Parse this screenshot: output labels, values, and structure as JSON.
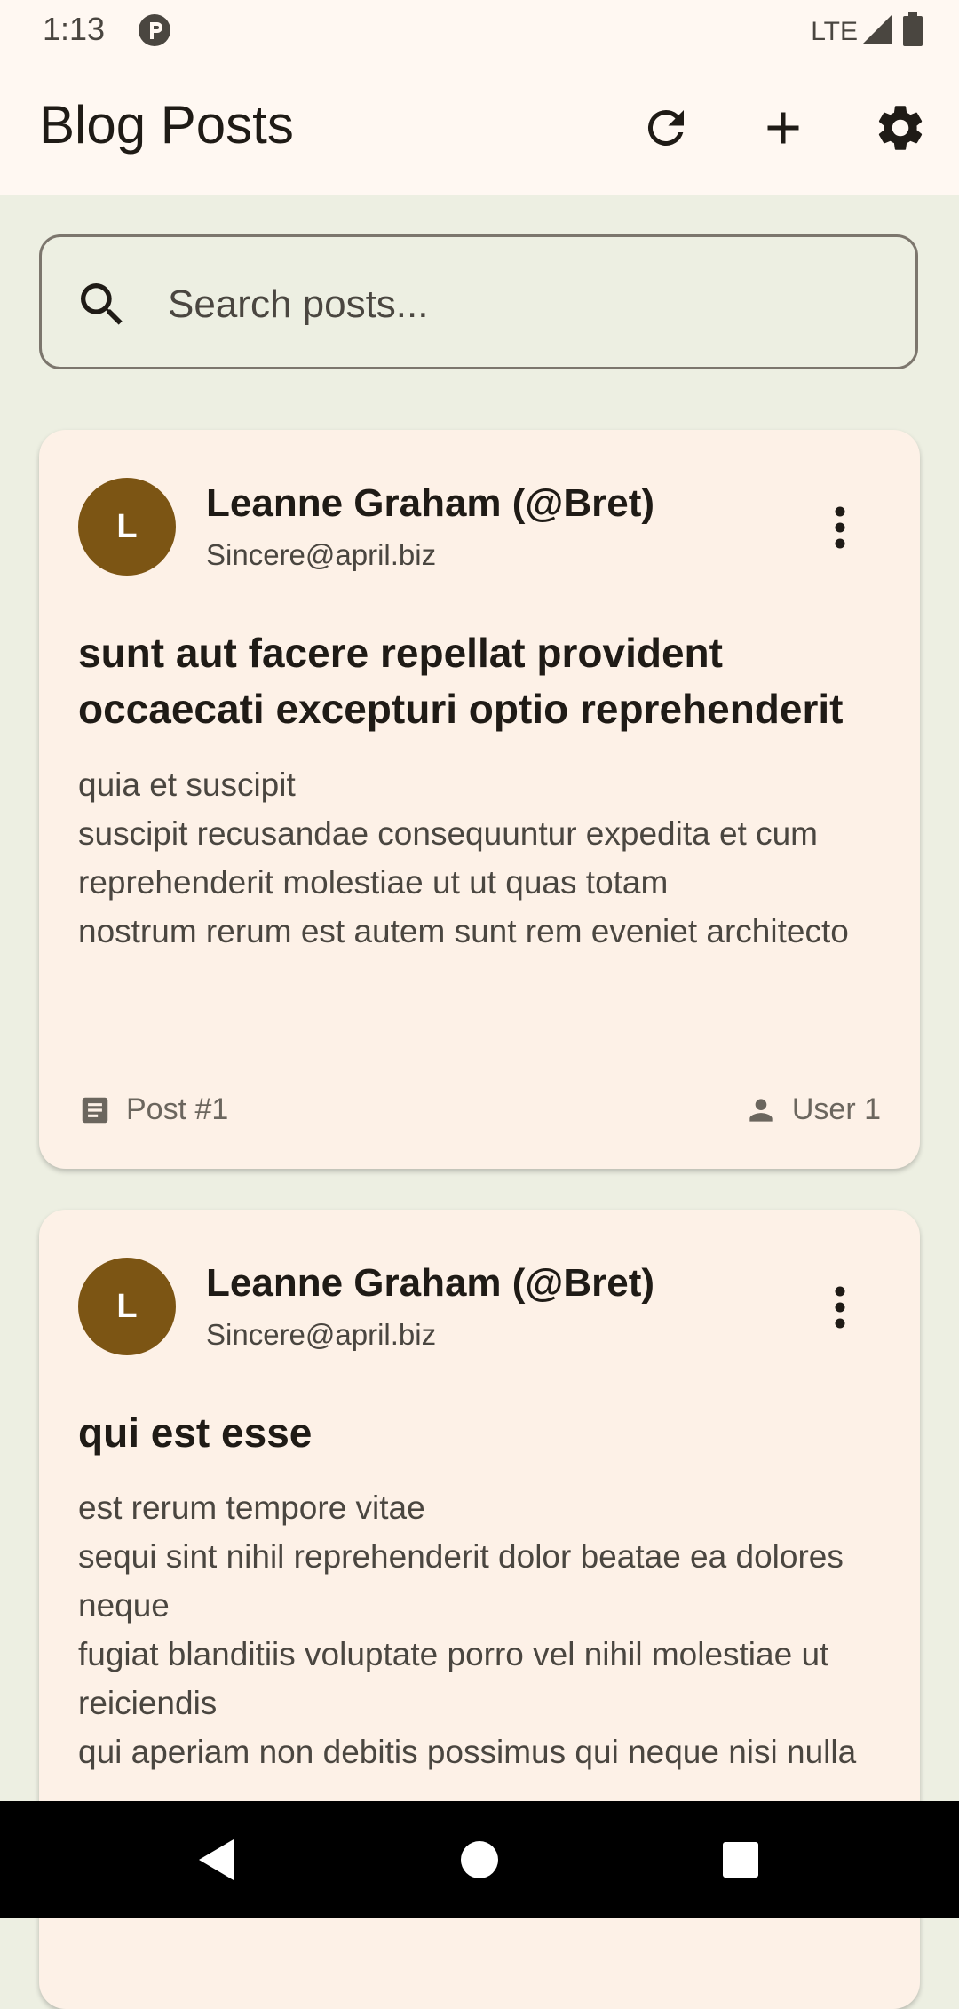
{
  "status_bar": {
    "time": "1:13",
    "network": "LTE"
  },
  "app_bar": {
    "title": "Blog Posts",
    "actions": [
      "refresh-icon",
      "add-icon",
      "settings-icon"
    ]
  },
  "search": {
    "placeholder": "Search posts..."
  },
  "posts": [
    {
      "author_initial": "L",
      "author_name": "Leanne Graham (@Bret)",
      "author_email": "Sincere@april.biz",
      "title": "sunt aut facere repellat provident occaecati excepturi optio reprehenderit",
      "body": "quia et suscipit\nsuscipit recusandae consequuntur expedita et cum\nreprehenderit molestiae ut ut quas totam\nnostrum rerum est autem sunt rem eveniet architecto",
      "post_label": "Post #1",
      "user_label": "User 1"
    },
    {
      "author_initial": "L",
      "author_name": "Leanne Graham (@Bret)",
      "author_email": "Sincere@april.biz",
      "title": "qui est esse",
      "body": "est rerum tempore vitae\nsequi sint nihil reprehenderit dolor beatae ea dolores neque\nfugiat blanditiis voluptate porro vel nihil molestiae ut reiciendis\nqui aperiam non debitis possimus qui neque nisi nulla"
    }
  ],
  "colors": {
    "background": "#edefe2",
    "card": "#fdf1e7",
    "avatar": "#7c5514",
    "text_primary": "#1f1b16",
    "text_secondary": "#4a4640"
  }
}
